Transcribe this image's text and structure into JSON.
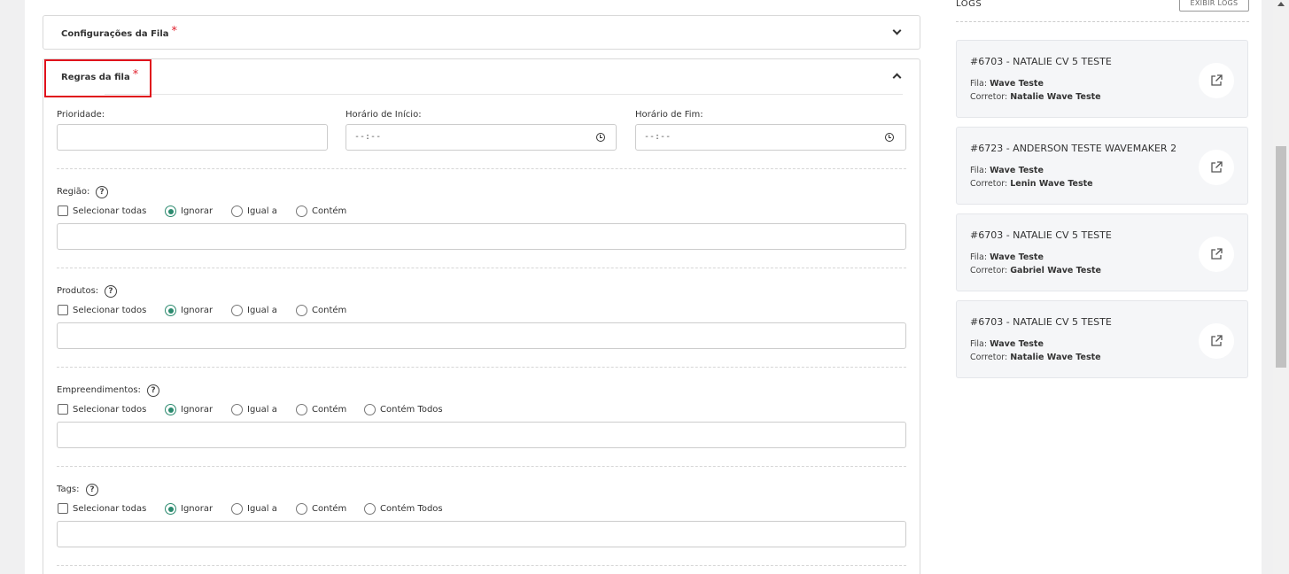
{
  "config_section": {
    "title": "Configurações da Fila",
    "required_mark": "*"
  },
  "rules_section": {
    "title": "Regras da fila",
    "required_mark": "*"
  },
  "fields": {
    "prioridade": {
      "label": "Prioridade:",
      "value": ""
    },
    "horario_inicio": {
      "label": "Horário de Início:",
      "value": "--:--"
    },
    "horario_fim": {
      "label": "Horário de Fim:",
      "value": "--:--"
    }
  },
  "filters": [
    {
      "label": "Região:",
      "help": "?",
      "options": [
        "Selecionar todas",
        "Ignorar",
        "Igual a",
        "Contém"
      ],
      "selected": "Ignorar"
    },
    {
      "label": "Produtos:",
      "help": "?",
      "options": [
        "Selecionar todos",
        "Ignorar",
        "Igual a",
        "Contém"
      ],
      "selected": "Ignorar"
    },
    {
      "label": "Empreendimentos:",
      "help": "?",
      "options": [
        "Selecionar todos",
        "Ignorar",
        "Igual a",
        "Contém",
        "Contém Todos"
      ],
      "selected": "Ignorar"
    },
    {
      "label": "Tags:",
      "help": "?",
      "options": [
        "Selecionar todas",
        "Ignorar",
        "Igual a",
        "Contém",
        "Contém Todos"
      ],
      "selected": "Ignorar"
    }
  ],
  "logs": {
    "title": "LOGS",
    "button_label": "EXIBIR LOGS",
    "fila_label": "Fila:",
    "corretor_label": "Corretor:",
    "entries": [
      {
        "title": "#6703 - NATALIE CV 5 TESTE",
        "fila": "Wave Teste",
        "corretor": "Natalie Wave Teste"
      },
      {
        "title": "#6723 - ANDERSON TESTE WAVEMAKER 2",
        "fila": "Wave Teste",
        "corretor": "Lenin Wave Teste"
      },
      {
        "title": "#6703 - NATALIE CV 5 TESTE",
        "fila": "Wave Teste",
        "corretor": "Gabriel Wave Teste"
      },
      {
        "title": "#6703 - NATALIE CV 5 TESTE",
        "fila": "Wave Teste",
        "corretor": "Natalie Wave Teste"
      }
    ]
  },
  "colors": {
    "accent_green": "#2b8a6e",
    "required_red": "#e0202e",
    "highlight_red": "#e0111c"
  }
}
